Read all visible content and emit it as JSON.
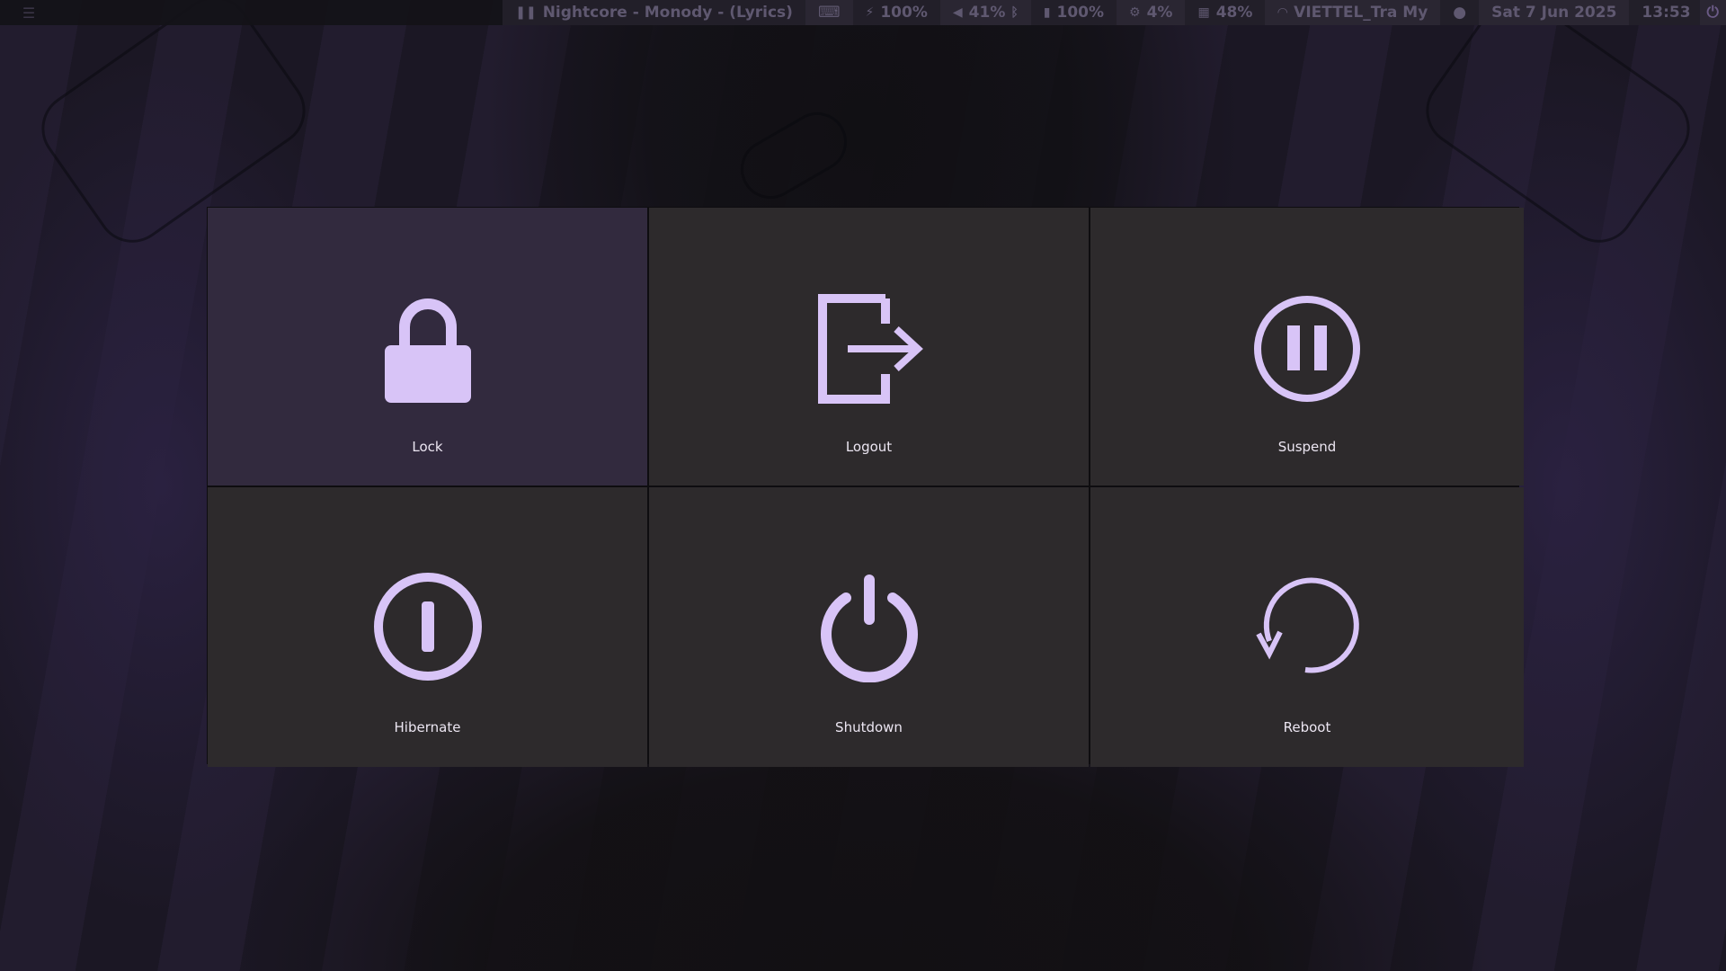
{
  "topbar": {
    "media": "Nightcore - Monody - (Lyrics)",
    "keyboard_icon": "keyboard-icon",
    "brightness": "100%",
    "volume": "41%",
    "battery": "100%",
    "cpu": "4%",
    "memory": "48%",
    "wifi": "VIETTEL_Tra My",
    "date": "Sat  7 Jun 2025",
    "time": "13:53"
  },
  "power_menu": {
    "accent_color": "#d8c4f7",
    "options": [
      {
        "label": "Lock",
        "icon": "lock-icon",
        "selected": true
      },
      {
        "label": "Logout",
        "icon": "logout-icon",
        "selected": false
      },
      {
        "label": "Suspend",
        "icon": "suspend-icon",
        "selected": false
      },
      {
        "label": "Hibernate",
        "icon": "hibernate-icon",
        "selected": false
      },
      {
        "label": "Shutdown",
        "icon": "shutdown-icon",
        "selected": false
      },
      {
        "label": "Reboot",
        "icon": "reboot-icon",
        "selected": false
      }
    ]
  }
}
